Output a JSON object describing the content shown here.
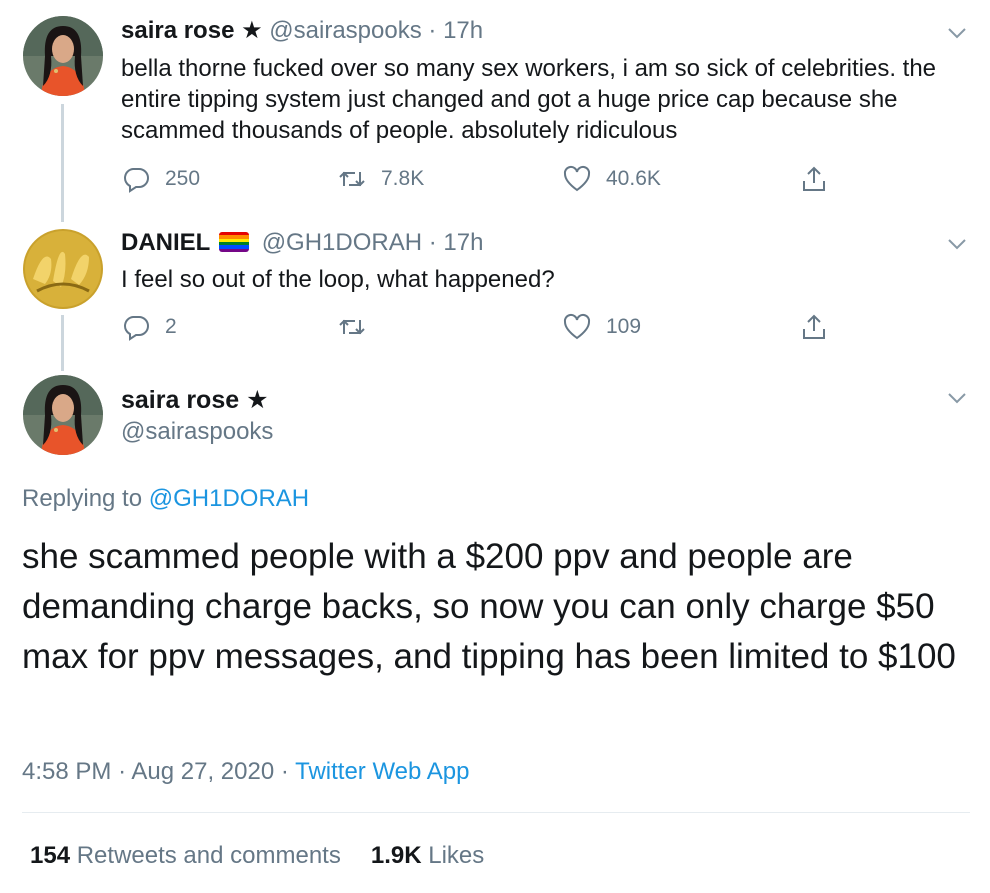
{
  "tweet1": {
    "name": "saira rose",
    "handle": "@sairaspooks",
    "time": "17h",
    "text": "bella thorne fucked over so many sex workers, i am so sick of celebrities. the entire tipping system just changed and got a huge price cap because she scammed thousands of people. absolutely ridiculous",
    "replies": "250",
    "retweets": "7.8K",
    "likes": "40.6K"
  },
  "tweet2": {
    "name": "DANIEL",
    "handle": "@GH1DORAH",
    "time": "17h",
    "text": "I feel so out of the loop, what happened?",
    "replies": "2",
    "retweets": "",
    "likes": "109"
  },
  "main": {
    "name": "saira rose",
    "handle": "@sairaspooks",
    "replying_prefix": "Replying to",
    "replying_to": "@GH1DORAH",
    "text": "she scammed people with a $200 ppv and people are demanding charge backs, so now you can only charge $50 max for ppv messages, and tipping has been limited to $100",
    "time": "4:58 PM",
    "date": "Aug 27, 2020",
    "app": "Twitter Web App",
    "retweet_count": "154",
    "retweet_label": "Retweets and comments",
    "like_count": "1.9K",
    "like_label": "Likes"
  },
  "separator": "·",
  "icons": {
    "verified_star": "star-icon",
    "reply": "reply-icon",
    "retweet": "retweet-icon",
    "like": "heart-icon",
    "share": "share-icon",
    "more": "chevron-down-icon",
    "flag": "rainbow-flag-icon"
  },
  "colors": {
    "text": "#14171a",
    "secondary": "#657786",
    "link": "#1b95e0",
    "thread_line": "#ccd6dd"
  }
}
